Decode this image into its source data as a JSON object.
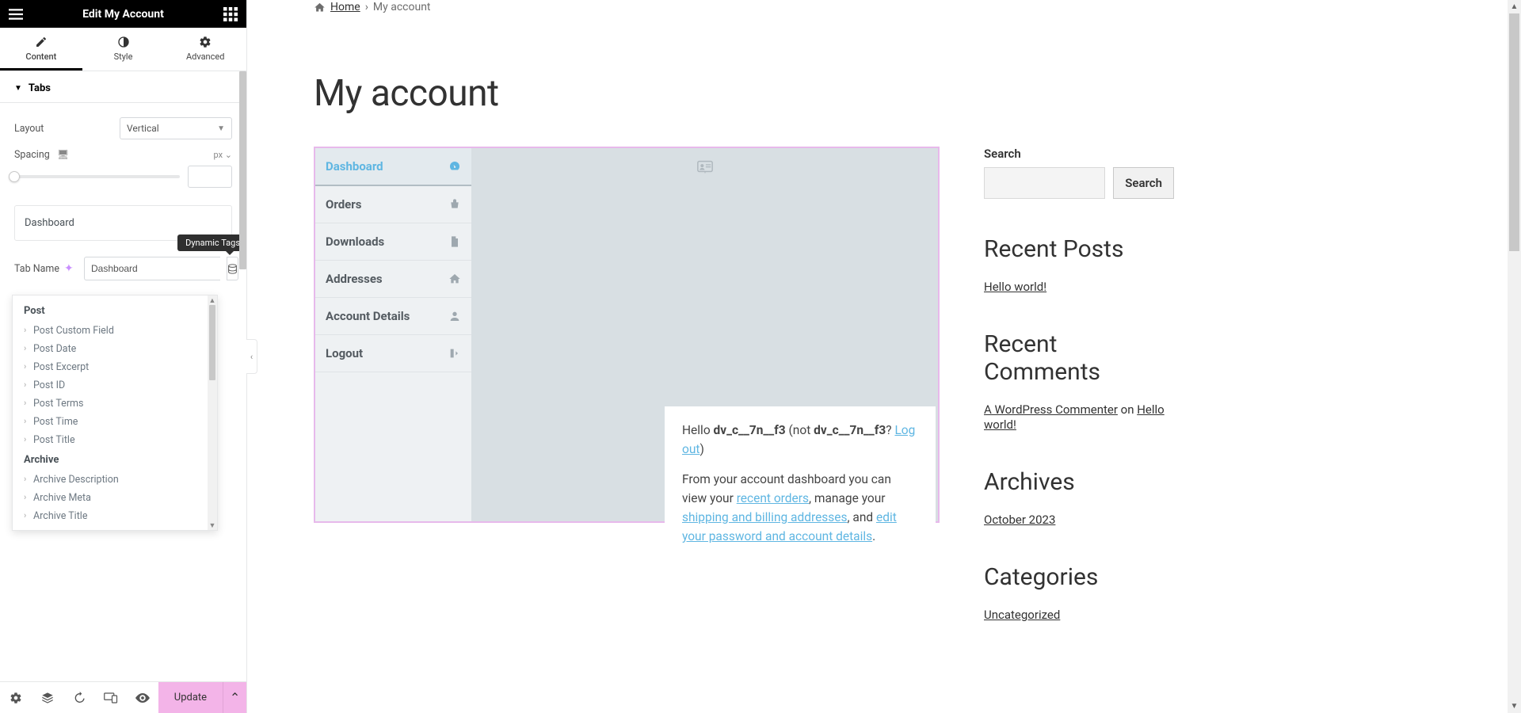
{
  "editor": {
    "title": "Edit My Account",
    "tabs": {
      "content": "Content",
      "style": "Style",
      "advanced": "Advanced"
    },
    "section_tabs": "Tabs",
    "layout_label": "Layout",
    "layout_value": "Vertical",
    "spacing_label": "Spacing",
    "spacing_unit": "px",
    "repeater_first": "Dashboard",
    "tab_name_label": "Tab Name",
    "tab_name_value": "Dashboard",
    "dyn_tooltip": "Dynamic Tags",
    "dropdown": {
      "group_post": "Post",
      "items_post": [
        "Post Custom Field",
        "Post Date",
        "Post Excerpt",
        "Post ID",
        "Post Terms",
        "Post Time",
        "Post Title"
      ],
      "group_archive": "Archive",
      "items_archive": [
        "Archive Description",
        "Archive Meta",
        "Archive Title"
      ]
    },
    "update": "Update"
  },
  "breadcrumb": {
    "home": "Home",
    "current": "My account"
  },
  "page_title": "My account",
  "account_nav": {
    "dashboard": "Dashboard",
    "orders": "Orders",
    "downloads": "Downloads",
    "addresses": "Addresses",
    "details": "Account Details",
    "logout": "Logout"
  },
  "dash": {
    "greet_pre": "Hello ",
    "user": "dv_c__7n__f3",
    "not_pre": " (not ",
    "not_user": "dv_c__7n__f3",
    "not_post": "? ",
    "logout": "Log out",
    "close": ")",
    "p2_a": "From your account dashboard you can view your ",
    "p2_link1": "recent orders",
    "p2_b": ", manage your ",
    "p2_link2": "shipping and billing addresses",
    "p2_c": ", and ",
    "p2_link3": "edit your password and account details",
    "p2_d": "."
  },
  "sidebar": {
    "search_label": "Search",
    "search_btn": "Search",
    "recent_posts_h": "Recent Posts",
    "recent_posts_item": "Hello world!",
    "recent_comments_h": "Recent Comments",
    "comment_author": "A WordPress Commenter",
    "comment_on": " on ",
    "comment_post": "Hello world!",
    "archives_h": "Archives",
    "archives_item": "October 2023",
    "categories_h": "Categories",
    "categories_item": "Uncategorized"
  }
}
